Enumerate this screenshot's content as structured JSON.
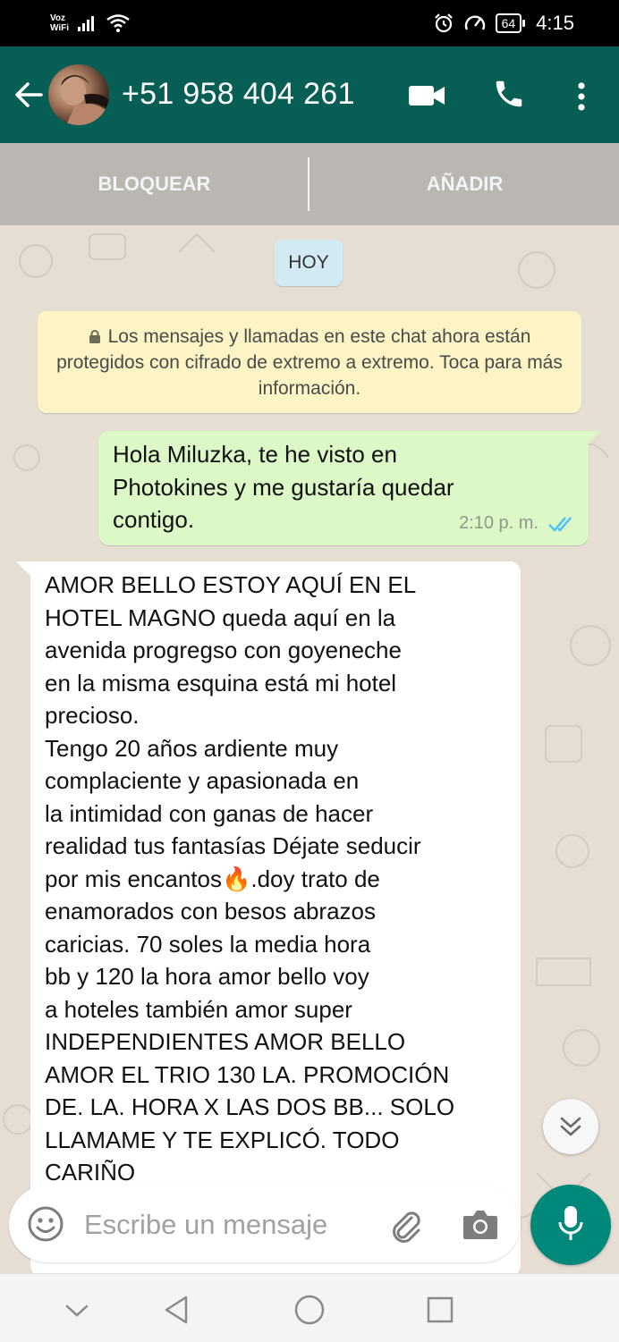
{
  "status_bar": {
    "carrier_label_top": "Voz",
    "carrier_label_bottom": "WiFi",
    "battery": "64",
    "time": "4:15",
    "icons": [
      "signal-icon",
      "wifi-icon",
      "alarm-icon",
      "speed-icon",
      "battery-icon"
    ]
  },
  "header": {
    "contact_name": "+51 958 404 261",
    "icons": [
      "back-arrow-icon",
      "video-call-icon",
      "phone-icon",
      "more-vert-icon"
    ]
  },
  "actions": {
    "block_label": "BLOQUEAR",
    "add_label": "AÑADIR"
  },
  "chat": {
    "date_label": "HOY",
    "encryption_notice": "Los mensajes y llamadas en este chat ahora están protegidos con cifrado de extremo a extremo. Toca para más información.",
    "messages": [
      {
        "direction": "outgoing",
        "text": "Hola Miluzka, te he visto en Photokines y me gustaría quedar contigo.",
        "time": "2:10 p. m.",
        "status": "read"
      },
      {
        "direction": "incoming",
        "text": "AMOR BELLO ESTOY AQUÍ EN EL\nHOTEL MAGNO queda aquí en la\navenida progregso con goyeneche\nen la misma esquina está mi hotel\nprecioso.\nTengo 20 años ardiente muy\ncomplaciente y apasionada en\nla intimidad con ganas de hacer\nrealidad tus fantasías Déjate seducir\npor mis encantos🔥.doy trato de\nenamorados con besos abrazos\ncaricias. 70 soles la media hora\nbb y 120 la hora amor bello  voy\na hoteles también amor super\nINDEPENDIENTES AMOR BELLO\nAMOR EL TRIO 130 LA. PROMOCIÓN\nDE. LA. HORA X LAS DOS BB...  SOLO\nLLAMAME Y TE EXPLICÓ. TODO\nCARIÑO"
      }
    ]
  },
  "composer": {
    "placeholder": "Escribe un mensaje",
    "value": ""
  },
  "colors": {
    "header": "#075e54",
    "outgoing_bubble": "#dcf8c6",
    "incoming_bubble": "#ffffff",
    "notice": "#fcf4c5",
    "date_chip": "#d3eaf5",
    "mic_button": "#00897b",
    "read_ticks": "#4fc3f7"
  }
}
